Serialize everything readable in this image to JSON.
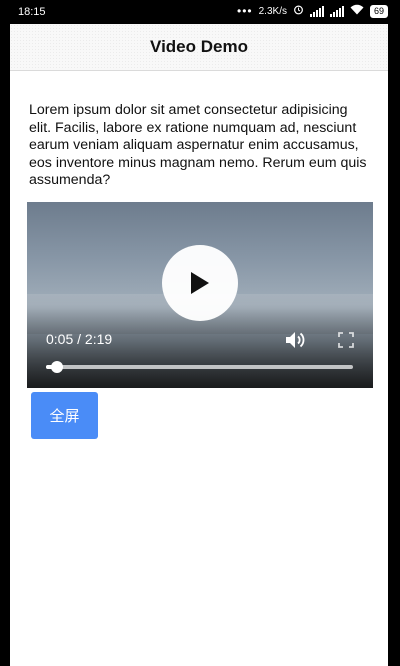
{
  "status_bar": {
    "time": "18:15",
    "dots": "•••",
    "network_speed": "2.3K/s",
    "battery": "69"
  },
  "header": {
    "title": "Video Demo"
  },
  "content": {
    "paragraph": "Lorem ipsum dolor sit amet consectetur adipisicing elit. Facilis, labore ex ratione numquam ad, nesciunt earum veniam aliquam aspernatur enim accusamus, eos inventore minus magnam nemo. Rerum eum quis assumenda?"
  },
  "video": {
    "current_time": "0:05",
    "duration": "2:19",
    "time_display": "0:05 / 2:19",
    "progress_fraction": 0.036,
    "icons": [
      "play-icon",
      "volume-icon",
      "fullscreen-icon"
    ]
  },
  "fullscreen_button": {
    "label": "全屏",
    "color": "#4a8cf7"
  }
}
